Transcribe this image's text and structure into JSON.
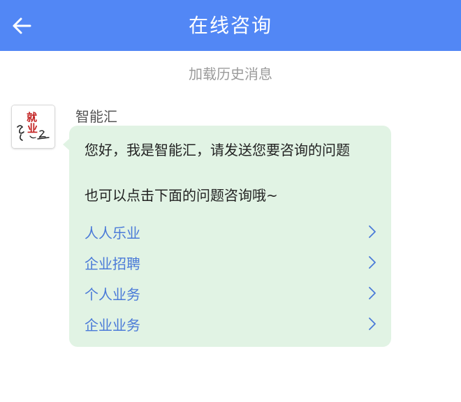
{
  "header": {
    "title": "在线咨询",
    "back_icon": "arrow-left-icon",
    "background_color": "#5287f5"
  },
  "history": {
    "load_label": "加载历史消息"
  },
  "message": {
    "sender": "智能汇",
    "avatar": {
      "icon": "jiuye-logo-icon",
      "logo_text": "就业"
    },
    "bubble_color": "#e1f3e4",
    "lines": [
      "您好，我是智能汇，请发送您要咨询的问题",
      "也可以点击下面的问题咨询哦~"
    ],
    "options": [
      {
        "label": "人人乐业",
        "icon": "chevron-right-icon"
      },
      {
        "label": "企业招聘",
        "icon": "chevron-right-icon"
      },
      {
        "label": "个人业务",
        "icon": "chevron-right-icon"
      },
      {
        "label": "企业业务",
        "icon": "chevron-right-icon"
      }
    ],
    "option_color": "#4a7ad8"
  }
}
